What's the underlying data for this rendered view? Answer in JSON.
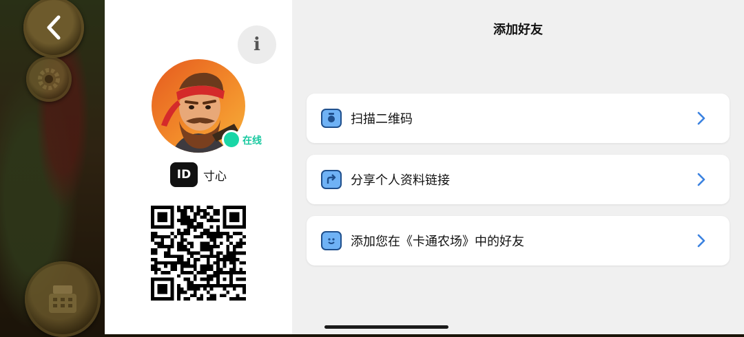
{
  "game": {
    "back_icon": "chevron-left-icon",
    "settings_icon": "gear-icon",
    "shop_icon": "cash-register-icon"
  },
  "profile": {
    "info_label": "i",
    "status": "在线",
    "status_color": "#19d6a6",
    "id_badge": "ID",
    "username": "寸心"
  },
  "main": {
    "title": "添加好友",
    "options": [
      {
        "label": "扫描二维码",
        "icon": "camera-icon"
      },
      {
        "label": "分享个人资料链接",
        "icon": "share-icon"
      },
      {
        "label": "添加您在《卡通农场》中的好友",
        "icon": "face-icon"
      }
    ],
    "accent_color": "#3b82e0"
  }
}
